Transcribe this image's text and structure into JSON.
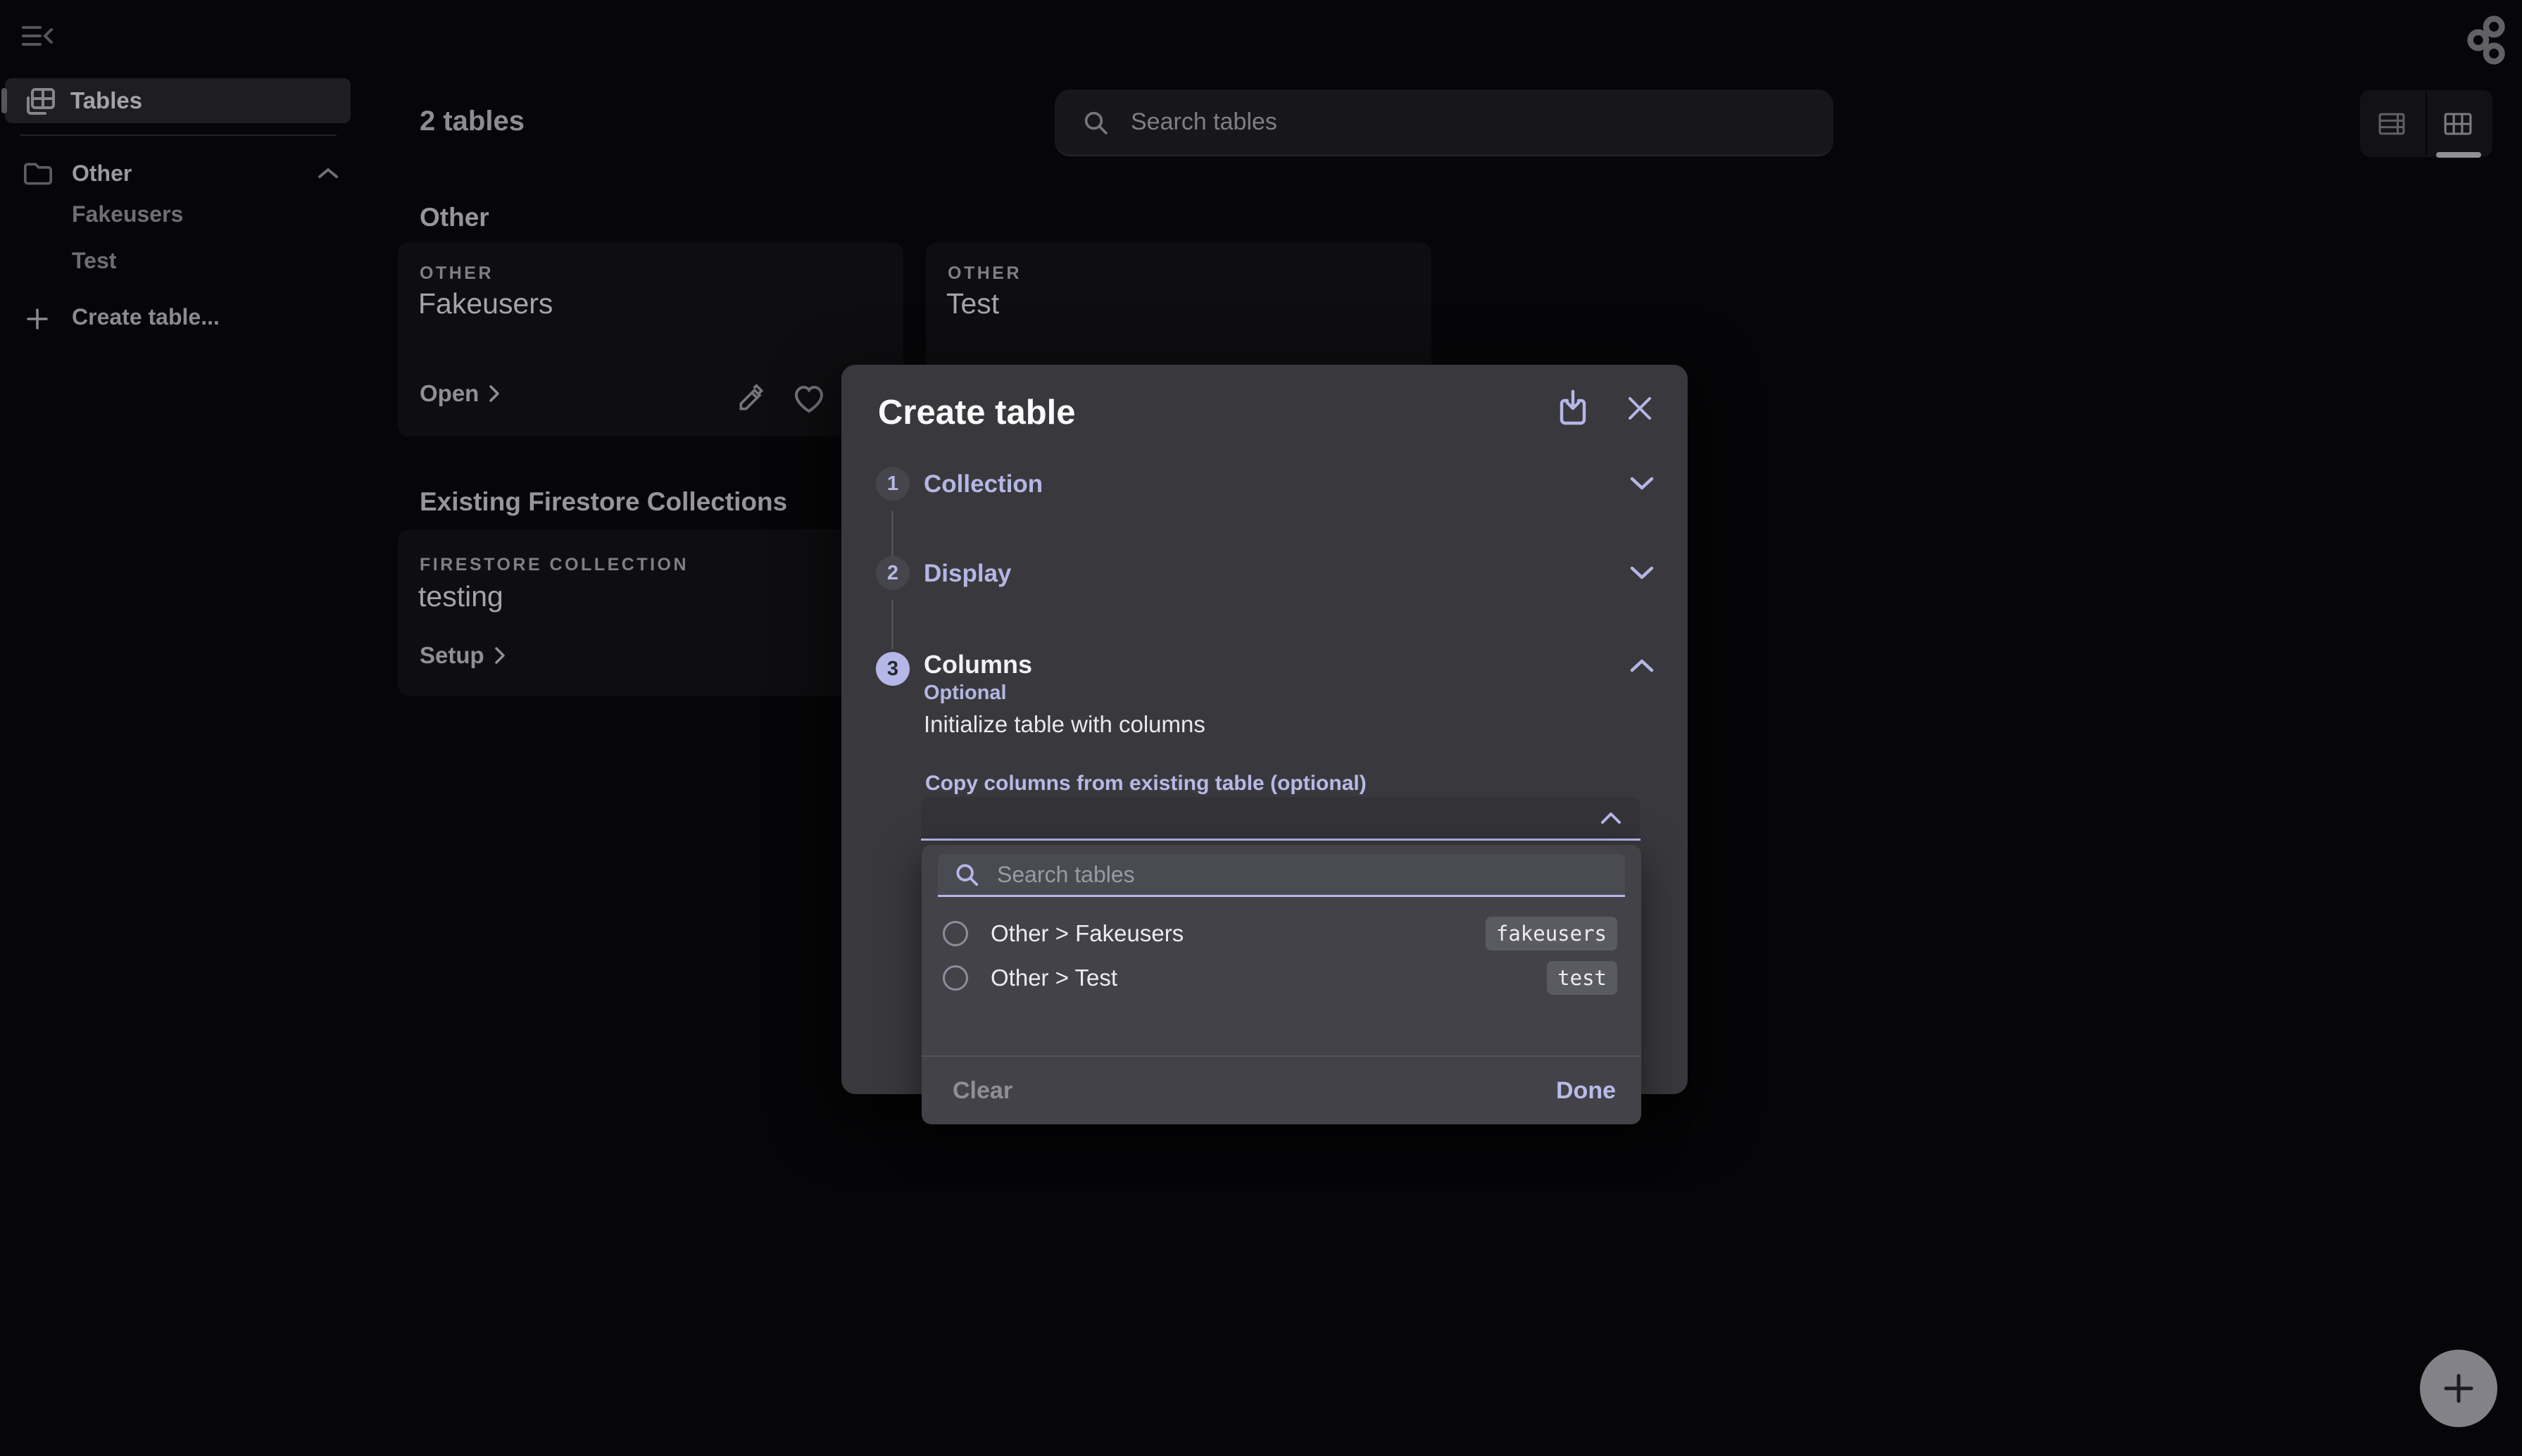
{
  "sidebar": {
    "tables_label": "Tables",
    "folder_label": "Other",
    "children": [
      {
        "label": "Fakeusers"
      },
      {
        "label": "Test"
      }
    ],
    "create_label": "Create table..."
  },
  "header": {
    "count": "2 tables",
    "search_placeholder": "Search tables"
  },
  "sections": {
    "other_title": "Other",
    "firestore_title": "Existing Firestore Collections"
  },
  "cards": [
    {
      "overline": "OTHER",
      "title": "Fakeusers",
      "action": "Open"
    },
    {
      "overline": "OTHER",
      "title": "Test"
    },
    {
      "overline": "FIRESTORE COLLECTION",
      "title": "testing",
      "action": "Setup"
    }
  ],
  "modal": {
    "title": "Create table",
    "steps": [
      {
        "num": "1",
        "label": "Collection"
      },
      {
        "num": "2",
        "label": "Display"
      },
      {
        "num": "3",
        "label": "Columns",
        "sub": "Optional"
      }
    ],
    "init_label": "Initialize table with columns",
    "copy_label": "Copy columns from existing table (optional)",
    "dropdown": {
      "search_placeholder": "Search tables",
      "options": [
        {
          "label": "Other > Fakeusers",
          "code": "fakeusers"
        },
        {
          "label": "Other > Test",
          "code": "test"
        }
      ],
      "clear": "Clear",
      "done": "Done"
    }
  },
  "colors": {
    "accent": "#b5b7e8",
    "modal_bg": "#39393d",
    "page_bg": "#060608"
  }
}
